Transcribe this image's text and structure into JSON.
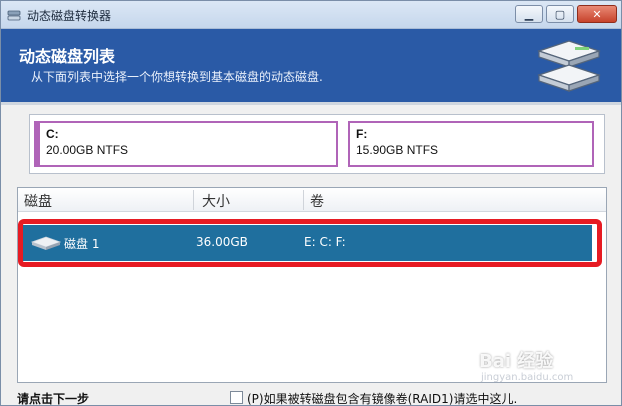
{
  "window": {
    "title": "动态磁盘转换器",
    "controls": {
      "minimize": "▁",
      "maximize": "▢",
      "close": "✕"
    }
  },
  "header": {
    "title": "动态磁盘列表",
    "subtitle": "从下面列表中选择一个你想转换到基本磁盘的动态磁盘."
  },
  "volumes": [
    {
      "letter": "C:",
      "info": "20.00GB NTFS"
    },
    {
      "letter": "F:",
      "info": "15.90GB NTFS"
    }
  ],
  "list": {
    "columns": [
      "磁盘",
      "大小",
      "卷"
    ],
    "rows": [
      {
        "disk": "磁盘 1",
        "size": "36.00GB",
        "volumes": "E:  C:  F:",
        "selected": true
      }
    ]
  },
  "footer": {
    "hint": "请点击下一步",
    "checkbox_label": "(P)如果被转磁盘包含有镜像卷(RAID1)请选中这儿."
  },
  "watermark": {
    "brand": "Bai 经验",
    "url": "jingyan.baidu.com"
  },
  "colors": {
    "header_bg": "#2a5aa6",
    "selection_bg": "#1f6f9e",
    "highlight_border": "#e61b23",
    "volume_border": "#b064b8"
  },
  "icons": {
    "app": "disk-converter-icon",
    "header": "stacked-disks-icon",
    "row": "hard-disk-icon"
  }
}
